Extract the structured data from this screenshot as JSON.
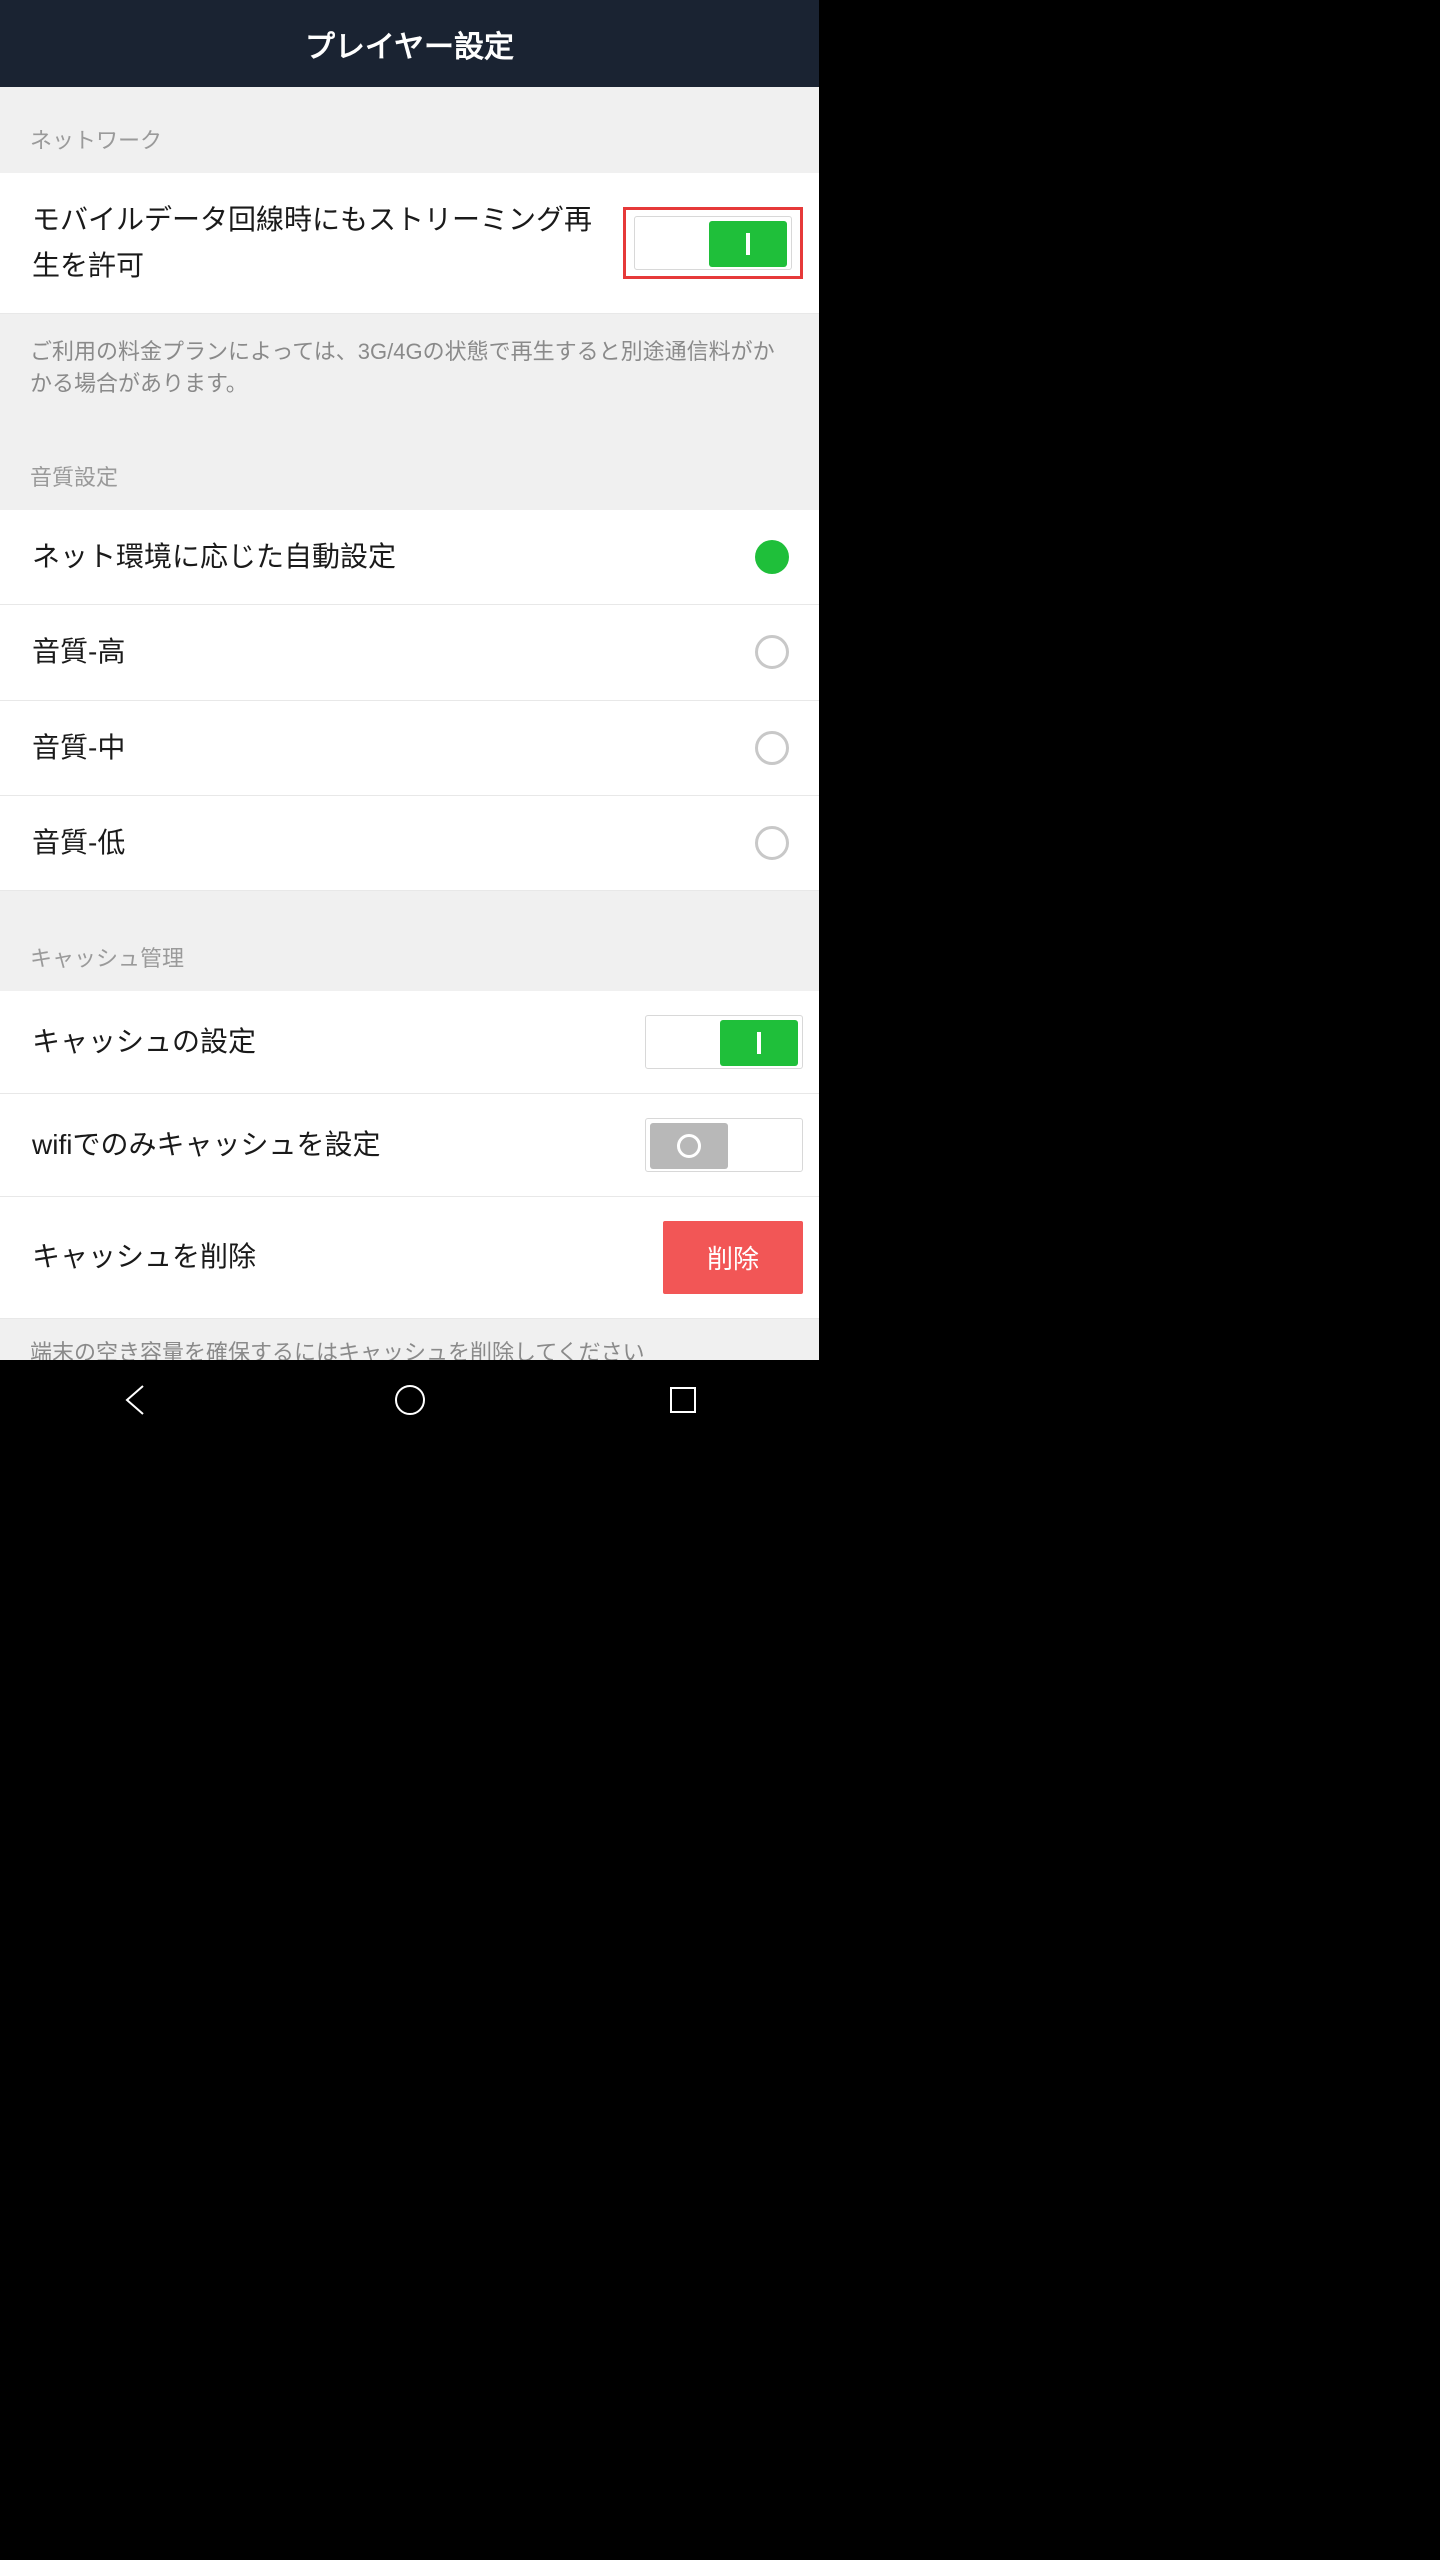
{
  "header": {
    "title": "プレイヤー設定"
  },
  "sections": {
    "network": {
      "header": "ネットワーク",
      "streaming_label": "モバイルデータ回線時にもストリーミング再生を許可",
      "streaming_on": true,
      "footnote": "ご利用の料金プランによっては、3G/4Gの状態で再生すると別途通信料がかかる場合があります。"
    },
    "quality": {
      "header": "音質設定",
      "options": [
        {
          "label": "ネット環境に応じた自動設定",
          "selected": true
        },
        {
          "label": "音質-高",
          "selected": false
        },
        {
          "label": "音質-中",
          "selected": false
        },
        {
          "label": "音質-低",
          "selected": false
        }
      ]
    },
    "cache": {
      "header": "キャッシュ管理",
      "cache_setting_label": "キャッシュの設定",
      "cache_setting_on": true,
      "wifi_only_label": "wifiでのみキャッシュを設定",
      "wifi_only_on": false,
      "delete_label": "キャッシュを削除",
      "delete_button": "削除",
      "footnote": "端末の空き容量を確保するにはキャッシュを削除してください"
    }
  }
}
